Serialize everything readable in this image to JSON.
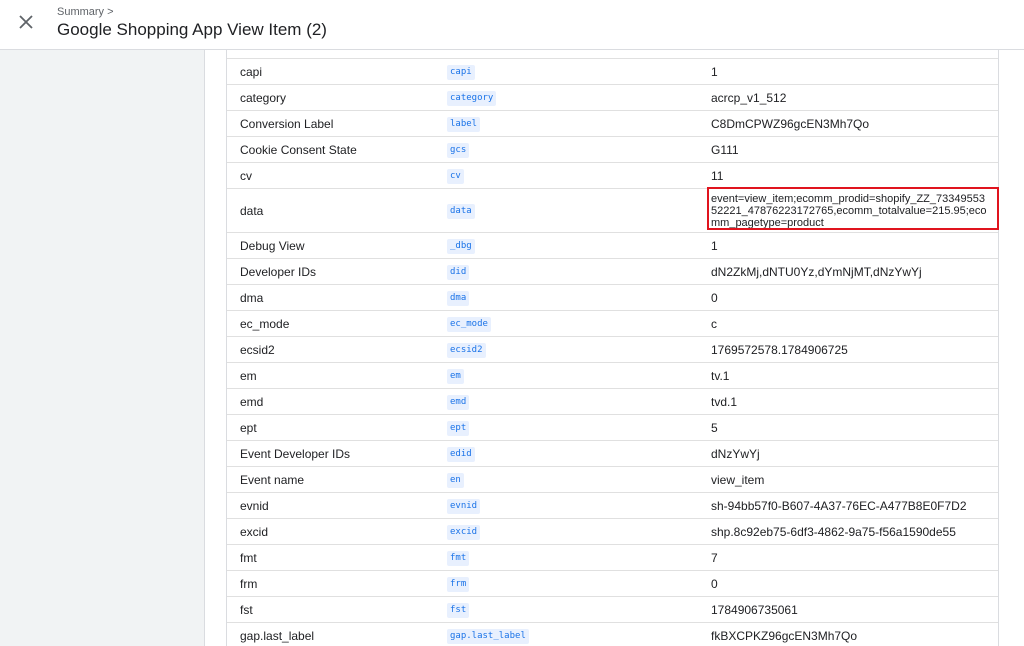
{
  "header": {
    "breadcrumb": "Summary >",
    "title": "Google Shopping App View Item (2)"
  },
  "rows": [
    {
      "name": "",
      "key": "",
      "value": ""
    },
    {
      "name": "capi",
      "key": "capi",
      "value": "1"
    },
    {
      "name": "category",
      "key": "category",
      "value": "acrcp_v1_512"
    },
    {
      "name": "Conversion Label",
      "key": "label",
      "value": "C8DmCPWZ96gcEN3Mh7Qo"
    },
    {
      "name": "Cookie Consent State",
      "key": "gcs",
      "value": "G111"
    },
    {
      "name": "cv",
      "key": "cv",
      "value": "11"
    },
    {
      "name": "data",
      "key": "data",
      "value": "event=view_item;ecomm_prodid=shopify_ZZ_7334955352221_47876223172765,ecomm_totalvalue=215.95;ecomm_pagetype=product"
    },
    {
      "name": "Debug View",
      "key": "_dbg",
      "value": "1"
    },
    {
      "name": "Developer IDs",
      "key": "did",
      "value": "dN2ZkMj,dNTU0Yz,dYmNjMT,dNzYwYj"
    },
    {
      "name": "dma",
      "key": "dma",
      "value": "0"
    },
    {
      "name": "ec_mode",
      "key": "ec_mode",
      "value": "c"
    },
    {
      "name": "ecsid2",
      "key": "ecsid2",
      "value": "1769572578.1784906725"
    },
    {
      "name": "em",
      "key": "em",
      "value": "tv.1"
    },
    {
      "name": "emd",
      "key": "emd",
      "value": "tvd.1"
    },
    {
      "name": "ept",
      "key": "ept",
      "value": "5"
    },
    {
      "name": "Event Developer IDs",
      "key": "edid",
      "value": "dNzYwYj"
    },
    {
      "name": "Event name",
      "key": "en",
      "value": "view_item"
    },
    {
      "name": "evnid",
      "key": "evnid",
      "value": "sh-94bb57f0-B607-4A37-76EC-A477B8E0F7D2"
    },
    {
      "name": "excid",
      "key": "excid",
      "value": "shp.8c92eb75-6df3-4862-9a75-f56a1590de55"
    },
    {
      "name": "fmt",
      "key": "fmt",
      "value": "7"
    },
    {
      "name": "frm",
      "key": "frm",
      "value": "0"
    },
    {
      "name": "fst",
      "key": "fst",
      "value": "1784906735061"
    },
    {
      "name": "gap.last_label",
      "key": "gap.last_label",
      "value": "fkBXCPKZ96gcEN3Mh7Qo"
    }
  ],
  "colors": {
    "highlight": "#e0141e",
    "chip_text": "#1a73e8",
    "chip_bg": "#e8f0fe"
  },
  "icons": {
    "close": "close-icon"
  }
}
